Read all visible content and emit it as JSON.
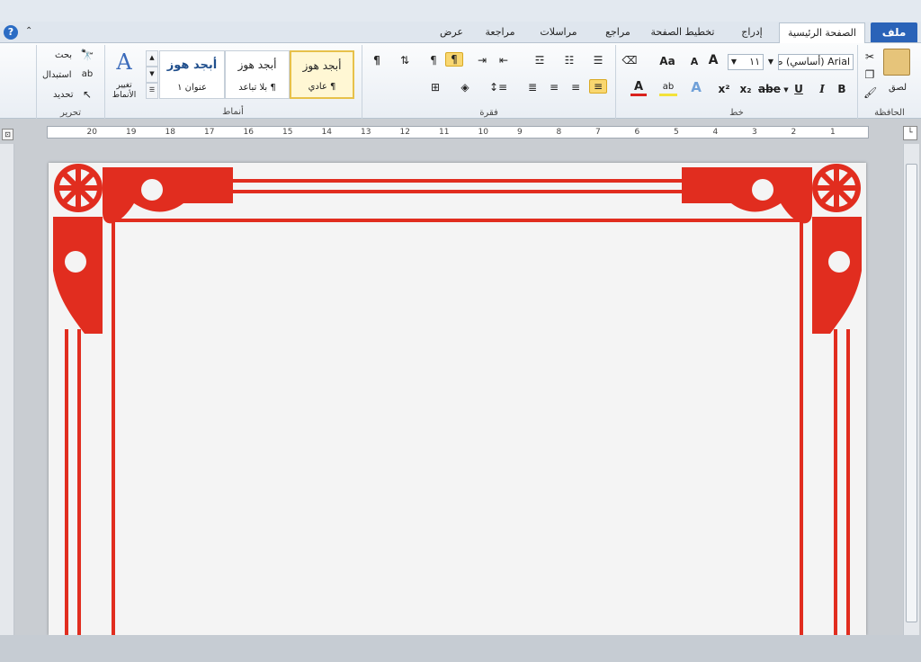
{
  "tabs": {
    "file": "ملف",
    "home": "الصفحة الرئيسية",
    "insert": "إدراج",
    "page_layout": "تخطيط الصفحة",
    "references": "مراجع",
    "mailings": "مراسلات",
    "review": "مراجعة",
    "view": "عرض"
  },
  "clipboard": {
    "paste_label": "لصق",
    "group_label": "الحافظة"
  },
  "font": {
    "font_name": "Arial (أساسي) ص",
    "font_size": "١١",
    "group_label": "خط",
    "bold": "B",
    "italic": "I",
    "underline": "U",
    "strike": "abe",
    "sub": "x₂",
    "sup": "x²",
    "grow": "A",
    "shrink": "A",
    "change_case": "Aa",
    "font_color_letter": "A",
    "accent_color": "#d9221d"
  },
  "paragraph": {
    "group_label": "فقرة"
  },
  "styles": {
    "group_label": "أنماط",
    "items": [
      {
        "preview": "أبجد هوز",
        "name": "¶ عادي"
      },
      {
        "preview": "أبجد هوز",
        "name": "¶ بلا تباعد"
      },
      {
        "preview": "أبجد هوز",
        "name": "عنوان ١"
      }
    ],
    "change_styles": "تغيير الأنماط"
  },
  "editing": {
    "group_label": "تحرير",
    "find": "بحث",
    "replace": "استبدال",
    "select": "تحديد"
  },
  "ruler": {
    "labels": [
      "1",
      "2",
      "3",
      "4",
      "5",
      "6",
      "7",
      "8",
      "9",
      "10",
      "11",
      "12",
      "13",
      "14",
      "15",
      "16",
      "17",
      "18",
      "19",
      "20"
    ]
  },
  "colors": {
    "border": "#e12d1f",
    "file_tab": "#2a63b8"
  }
}
